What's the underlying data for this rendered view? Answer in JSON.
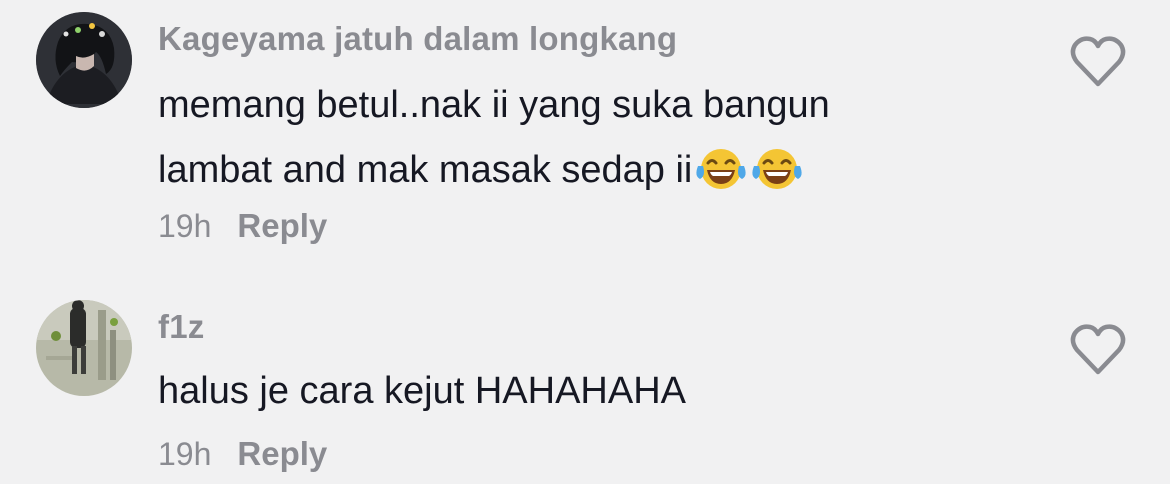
{
  "comments": [
    {
      "username": "Kageyama jatuh dalam longkang",
      "text_lines": [
        "memang betul..nak ii yang suka bangun",
        "lambat and mak masak sedap ii"
      ],
      "emoji": [
        "face-with-tears-of-joy",
        "face-with-tears-of-joy"
      ],
      "time": "19h",
      "reply_label": "Reply"
    },
    {
      "username": "f1z",
      "text_lines": [
        "halus je cara kejut HAHAHAHA"
      ],
      "time": "19h",
      "reply_label": "Reply"
    }
  ],
  "icons": {
    "like": "heart-outline-icon"
  },
  "colors": {
    "background": "#f1f1f2",
    "muted": "#8a8b91",
    "text": "#161823"
  }
}
